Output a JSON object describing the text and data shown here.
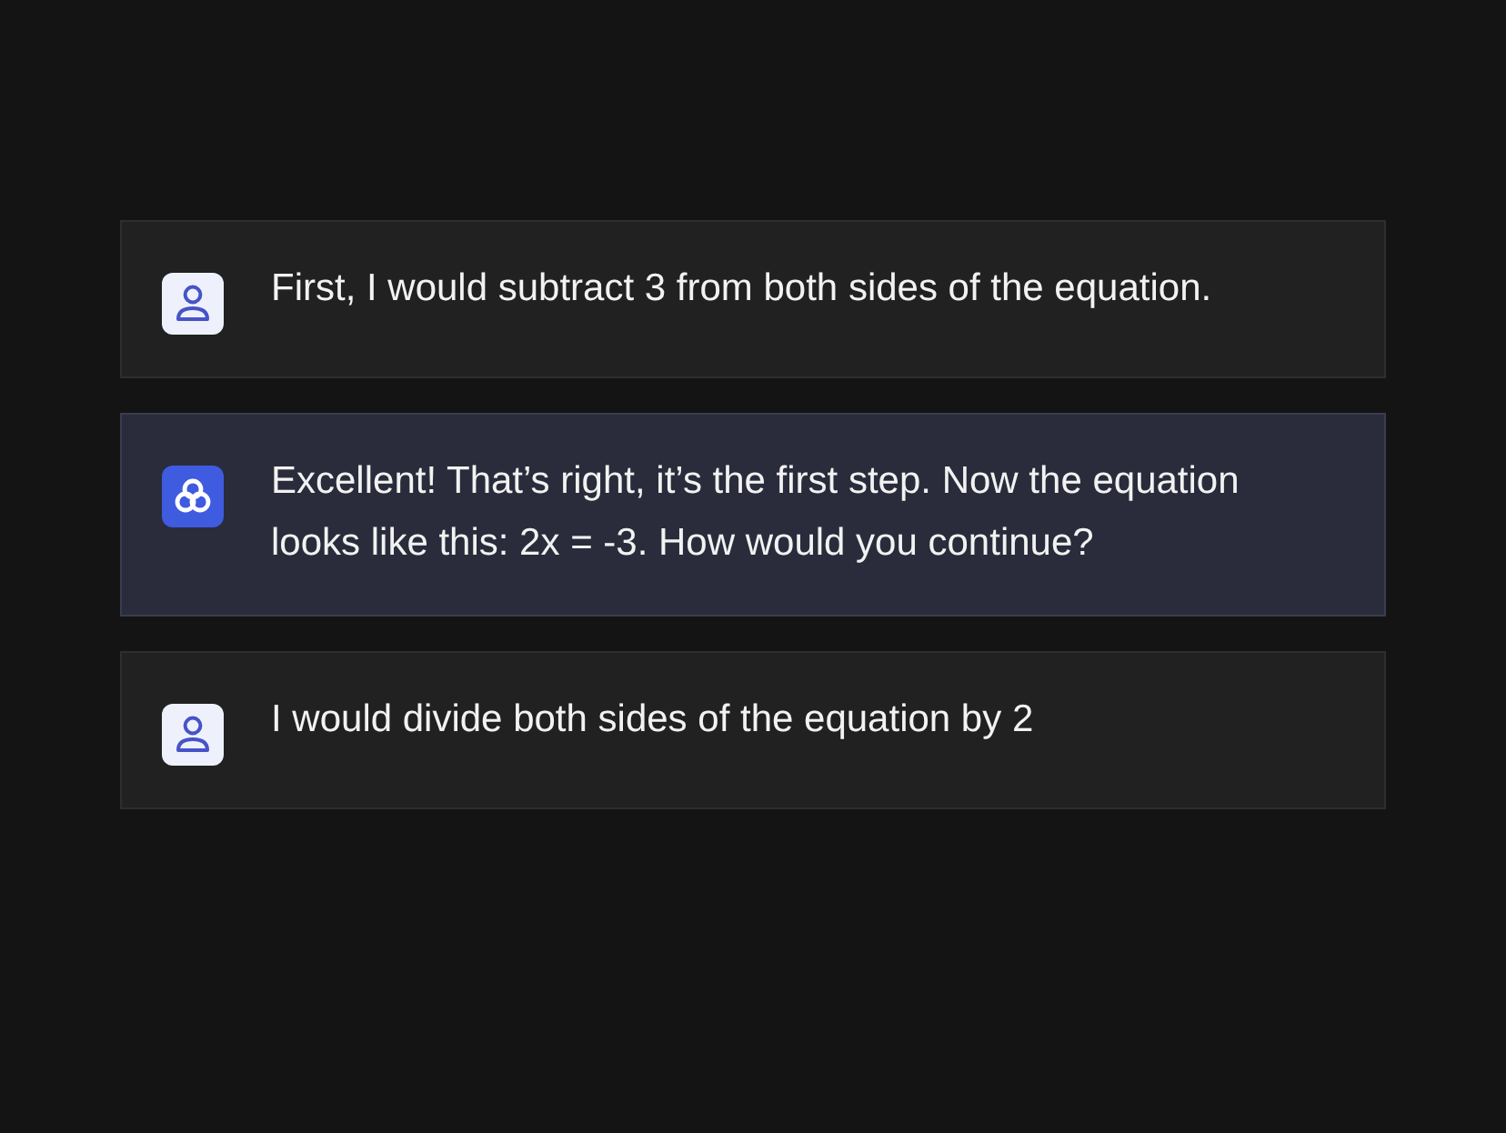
{
  "messages": [
    {
      "kind": "user",
      "text": "First, I would subtract 3 from both sides of the equation."
    },
    {
      "kind": "assistant",
      "text": "Excellent! That’s right, it’s the first step. Now the equation looks like this: 2x = -3. How would you continue?"
    },
    {
      "kind": "user",
      "text": "I would divide both sides of the equation by 2"
    }
  ]
}
